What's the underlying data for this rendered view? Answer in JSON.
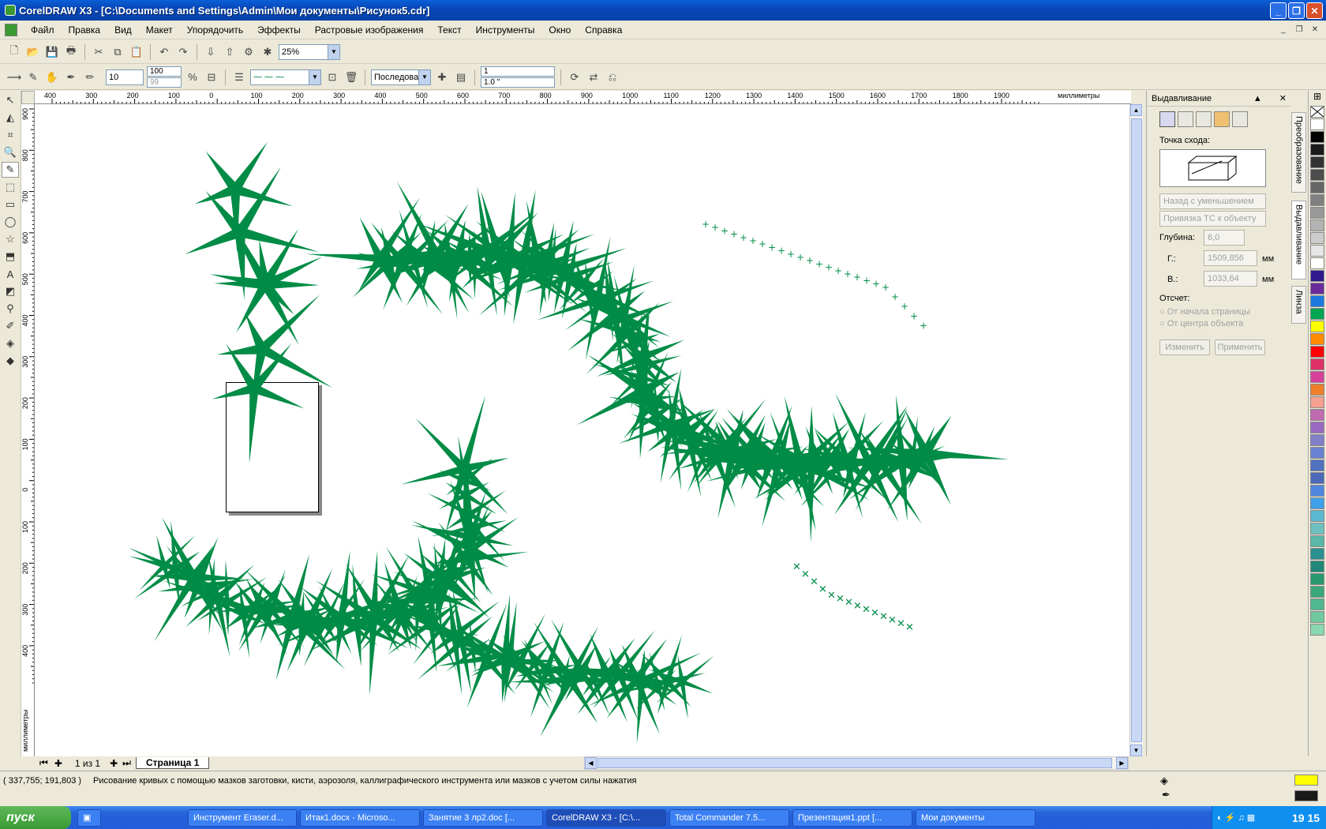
{
  "window": {
    "title": "CorelDRAW X3 - [C:\\Documents and Settings\\Admin\\Мои документы\\Рисунок5.cdr]"
  },
  "menu": [
    "Файл",
    "Правка",
    "Вид",
    "Макет",
    "Упорядочить",
    "Эффекты",
    "Растровые изображения",
    "Текст",
    "Инструменты",
    "Окно",
    "Справка"
  ],
  "toolbar": {
    "zoom": "25%",
    "size": "10",
    "pct_a": "100",
    "pct_b": "99",
    "stroke_type": "Последоват",
    "spacing": "1",
    "angle": "1.0 \""
  },
  "ruler": {
    "h_labels": [
      "400",
      "300",
      "200",
      "100",
      "0",
      "100",
      "200",
      "300",
      "400",
      "500",
      "600",
      "700",
      "800",
      "900",
      "1000",
      "1100",
      "1200",
      "1300",
      "1400",
      "1500",
      "1600",
      "1700",
      "1800",
      "1900"
    ],
    "h_unit": "миллиметры",
    "v_labels": [
      "900",
      "800",
      "700",
      "600",
      "500",
      "400",
      "300",
      "200",
      "100",
      "0",
      "100",
      "200",
      "300",
      "400"
    ],
    "v_unit": "миллиметры"
  },
  "pagebar": {
    "page_count": "1 из 1",
    "page_tab": "Страница 1"
  },
  "docker": {
    "title": "Выдавливание",
    "vanishing_label": "Точка схода:",
    "combo1": "Назад с уменьшением",
    "combo2": "Привязка ТС к объекту",
    "depth_label": "Глубина:",
    "depth": "6,0",
    "h_label": "Г.:",
    "h_value": "1509,856",
    "v_label": "В.:",
    "v_value": "1033,64",
    "unit": "мм",
    "ref_label": "Отсчет:",
    "radio1": "От начала страницы",
    "radio2": "От центра объекта",
    "edit_btn": "Изменить",
    "apply_btn": "Применить"
  },
  "docker_tabs": [
    "Преобразование",
    "Выдавливание",
    "Линза"
  ],
  "palette_colors": [
    "#ffffff",
    "#000000",
    "#1a1a1a",
    "#333333",
    "#4d4d4d",
    "#666666",
    "#808080",
    "#999999",
    "#b3b3b3",
    "#cccccc",
    "#e6e6e6",
    "#ffffff",
    "#2e1a8c",
    "#6a2a9c",
    "#1e7ae0",
    "#00a651",
    "#ffff00",
    "#ff8c00",
    "#ff0000",
    "#e0306a",
    "#d8409a",
    "#f07f2a",
    "#f5a090",
    "#c06ab0",
    "#9a6ac0",
    "#8080c8",
    "#6a80d0",
    "#5070c0",
    "#4a6ab8",
    "#4f86e0",
    "#3ea0e8",
    "#5ab8d0",
    "#70c0c0",
    "#5ab8a8",
    "#2a8f8f",
    "#208878",
    "#2a9870",
    "#3aa878",
    "#50b890",
    "#70c8a0",
    "#8ad8b0"
  ],
  "status": {
    "coords": "( 337,755; 191,803 )",
    "message": "Рисование кривых с помощью мазков заготовки, кисти, аэрозоля, каллиграфического инструмента или мазков с учетом силы нажатия"
  },
  "taskbar": {
    "start": "пуск",
    "tasks": [
      "Инструмент Eraser.d...",
      "Итак1.docx - Microso...",
      "Занятие 3 лр2.doc [...",
      "CorelDRAW X3 - [C:\\...",
      "Total Commander 7.5...",
      "Презентация1.ppt [...",
      "Мои документы"
    ],
    "clock": "19 15"
  },
  "colors": {
    "spike": "#008c46"
  }
}
